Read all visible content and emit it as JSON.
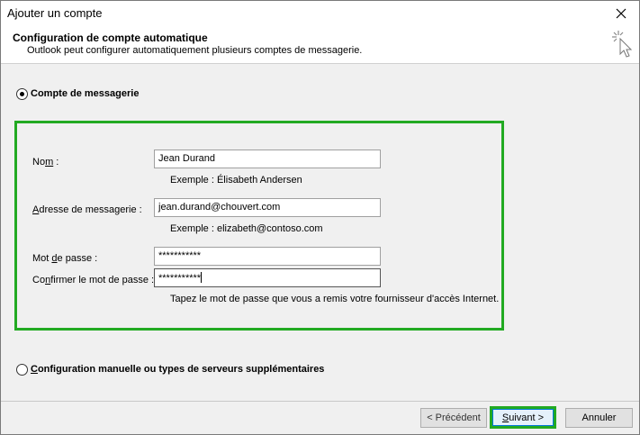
{
  "window": {
    "title": "Ajouter un compte"
  },
  "header": {
    "title": "Configuration de compte automatique",
    "subtitle": "Outlook peut configurer automatiquement plusieurs comptes de messagerie."
  },
  "option_auto": {
    "label": "Compte de messagerie",
    "selected": true
  },
  "form": {
    "name": {
      "label_pre": "No",
      "label_ul": "m",
      "label_post": " :",
      "value": "Jean Durand",
      "example": "Exemple : Élisabeth Andersen"
    },
    "email": {
      "label_pre": "",
      "label_ul": "A",
      "label_post": "dresse de messagerie :",
      "value": "jean.durand@chouvert.com",
      "example": "Exemple : elizabeth@contoso.com"
    },
    "password": {
      "label_pre": "Mot ",
      "label_ul": "d",
      "label_post": "e passe :",
      "value": "***********"
    },
    "confirm": {
      "label_pre": "Co",
      "label_ul": "n",
      "label_post": "firmer le mot de passe :",
      "value": "***********"
    },
    "hint": "Tapez le mot de passe que vous a remis votre fournisseur d'accès Internet."
  },
  "option_manual": {
    "label_pre": "",
    "label_ul": "C",
    "label_post": "onfiguration manuelle ou types de serveurs supplémentaires",
    "selected": false
  },
  "buttons": {
    "back": "< Précédent",
    "next_ul": "S",
    "next_post": "uivant >",
    "cancel": "Annuler"
  }
}
